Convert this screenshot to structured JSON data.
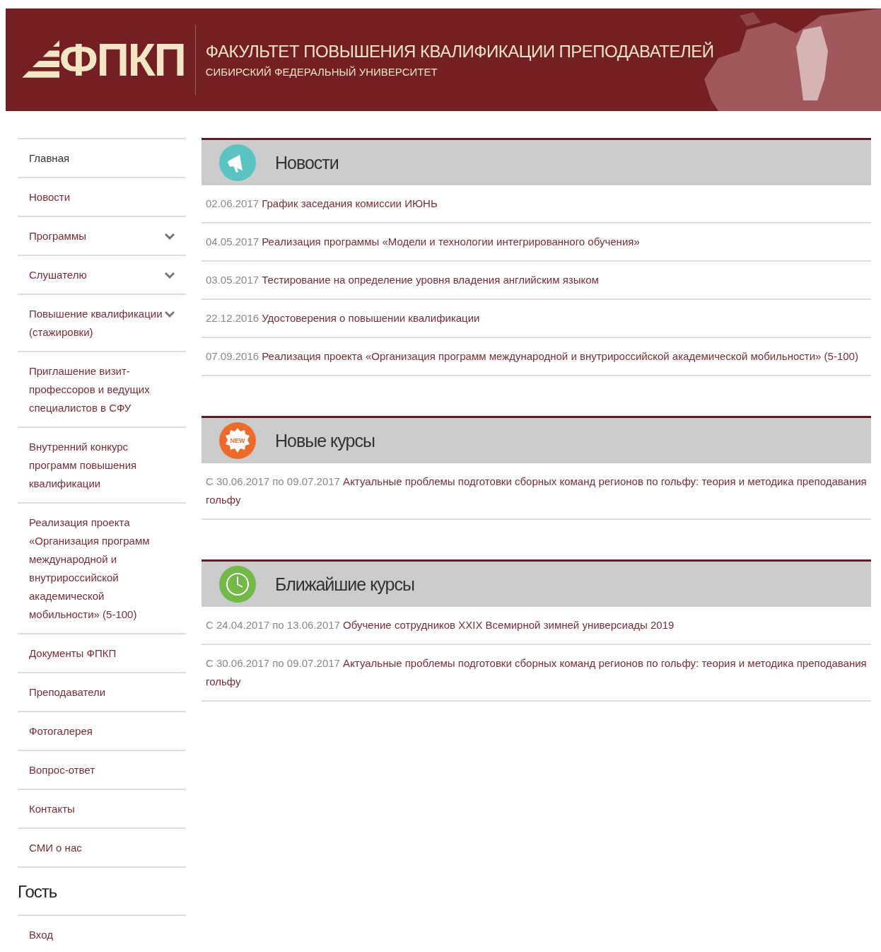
{
  "header": {
    "logo": "ФПКП",
    "title": "ФАКУЛЬТЕТ ПОВЫШЕНИЯ КВАЛИФИКАЦИИ ПРЕПОДАВАТЕЛЕЙ",
    "subtitle": "СИБИРСКИЙ ФЕДЕРАЛЬНЫЙ УНИВЕРСИТЕТ"
  },
  "menu": [
    {
      "label": "Главная",
      "selected": true,
      "has_submenu": false
    },
    {
      "label": "Новости",
      "selected": false,
      "has_submenu": false
    },
    {
      "label": "Программы",
      "selected": false,
      "has_submenu": true
    },
    {
      "label": "Слушателю",
      "selected": false,
      "has_submenu": true
    },
    {
      "label": "Повышение квалификации (стажировки)",
      "selected": false,
      "has_submenu": true
    },
    {
      "label": "Приглашение визит-профессоров и ведущих специалистов в СФУ",
      "selected": false,
      "has_submenu": false
    },
    {
      "label": "Внутренний конкурс программ повышения квалификации",
      "selected": false,
      "has_submenu": false
    },
    {
      "label": "Реализация проекта «Организация программ международной и внутрироссийской академической мобильности» (5-100)",
      "selected": false,
      "has_submenu": false
    },
    {
      "label": "Документы ФПКП",
      "selected": false,
      "has_submenu": false
    },
    {
      "label": "Преподаватели",
      "selected": false,
      "has_submenu": false
    },
    {
      "label": "Фотогалерея",
      "selected": false,
      "has_submenu": false
    },
    {
      "label": "Вопрос-ответ",
      "selected": false,
      "has_submenu": false
    },
    {
      "label": "Контакты",
      "selected": false,
      "has_submenu": false
    },
    {
      "label": "СМИ о нас",
      "selected": false,
      "has_submenu": false
    }
  ],
  "user": {
    "heading": "Гость",
    "links": [
      "Вход"
    ]
  },
  "sections": [
    {
      "kind": "news",
      "title": "Новости",
      "items": [
        {
          "date": "02.06.2017",
          "title": "График заседания комиссии ИЮНЬ"
        },
        {
          "date": "04.05.2017",
          "title": "Реализация программы «Модели и технологии интегрированного обучения»"
        },
        {
          "date": "03.05.2017",
          "title": "Тестирование на определение уровня владения английским языком"
        },
        {
          "date": "22.12.2016",
          "title": "Удостоверения о повышении квалификации"
        },
        {
          "date": "07.09.2016",
          "title": "Реализация проекта «Организация программ международной и внутрироссийской академической мобильности» (5-100)"
        }
      ]
    },
    {
      "kind": "new",
      "badge": "NEW",
      "title": "Новые курсы",
      "items": [
        {
          "date": "С 30.06.2017 по 09.07.2017",
          "title": "Актуальные проблемы подготовки сборных команд регионов по гольфу: теория и методика преподавания гольфу"
        }
      ]
    },
    {
      "kind": "clock",
      "title": "Ближайшие курсы",
      "items": [
        {
          "date": "С 24.04.2017 по 13.06.2017",
          "title": "Обучение сотрудников XXIX Всемирной зимней универсиады 2019"
        },
        {
          "date": "С 30.06.2017 по 09.07.2017",
          "title": "Актуальные проблемы подготовки сборных команд регионов по гольфу: теория и методика преподавания гольфу"
        }
      ]
    }
  ]
}
